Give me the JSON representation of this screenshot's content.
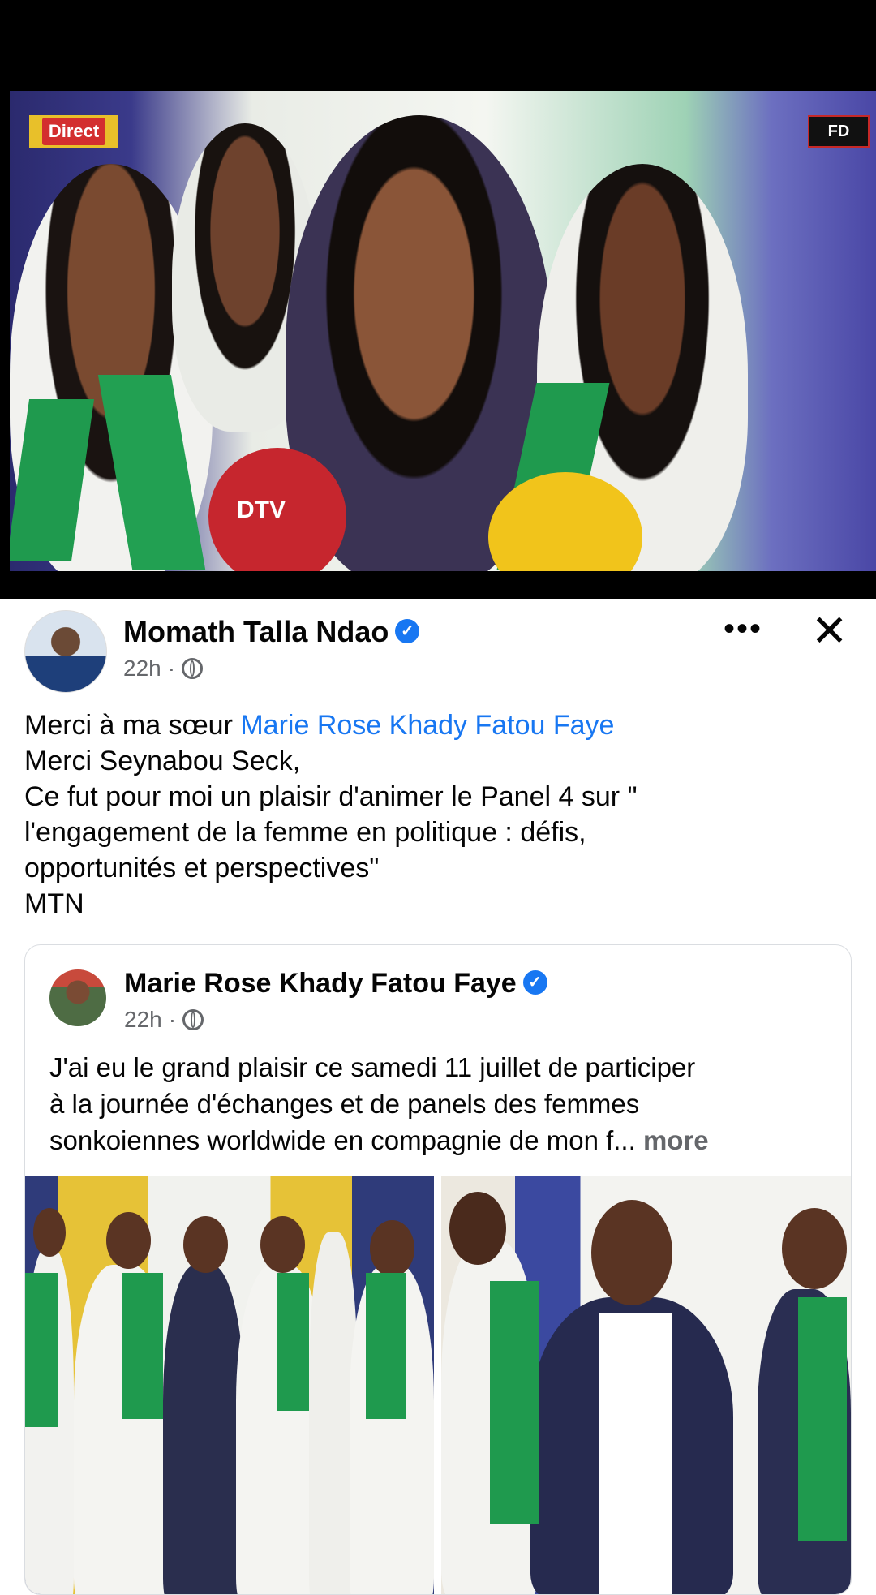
{
  "video": {
    "live_badge": "Direct",
    "channel_logo": "FD",
    "mic_label": "DTV"
  },
  "post": {
    "author": "Momath Talla Ndao",
    "time": "22h",
    "lines": {
      "line1_prefix": "Merci à ma sœur ",
      "line1_link": "Marie Rose Khady Fatou Faye",
      "line2": "Merci Seynabou Seck,",
      "line3": "Ce fut pour moi un plaisir d'animer le Panel 4 sur \"",
      "line4": "l'engagement de la femme en politique : défis,",
      "line5": "opportunités et perspectives\"",
      "line6": "MTN"
    },
    "icons": {
      "more": "more-options-icon",
      "close": "close-icon",
      "audience": "globe-icon",
      "verified": "verified-badge-icon"
    }
  },
  "shared": {
    "author": "Marie Rose Khady Fatou Faye",
    "time": "22h",
    "lines": {
      "line1": "J'ai eu le grand plaisir ce samedi 11 juillet de participer",
      "line2": "à la journée d'échanges et de panels des femmes",
      "line3_text": "sonkoiennes worldwide en compagnie de mon f...",
      "line3_more": "more"
    }
  },
  "colors": {
    "link": "#1877f2",
    "secondary_text": "#65676b",
    "scarf_green": "#1f9a4e"
  }
}
